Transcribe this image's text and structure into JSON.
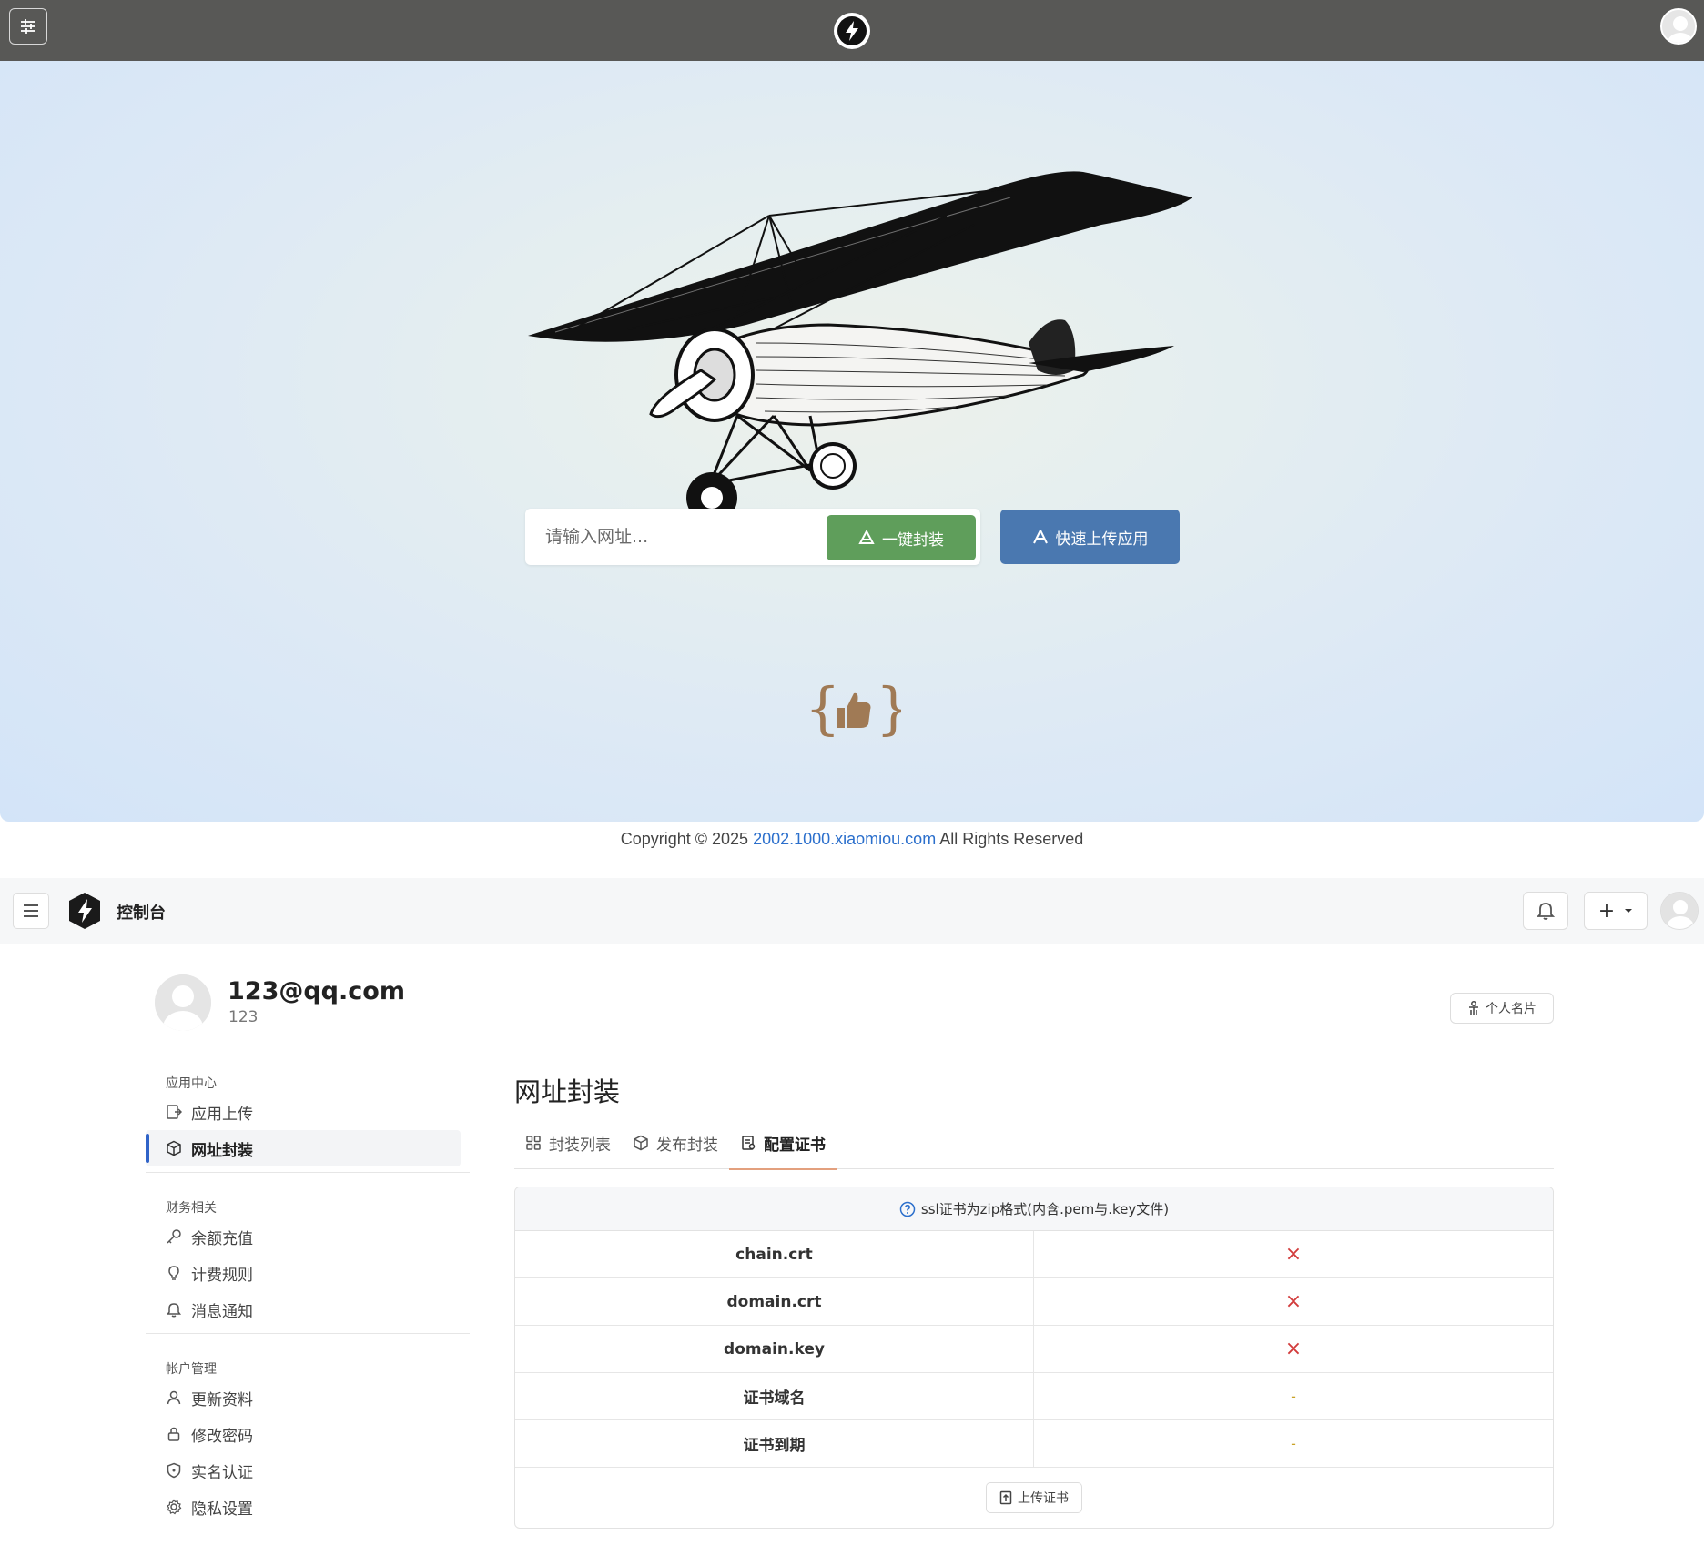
{
  "top": {
    "url_placeholder": "请输入网址...",
    "pack_button": "一键封装",
    "upload_button": "快速上传应用",
    "copyright_prefix": "Copyright © 2025 ",
    "copyright_link": "2002.1000.xiaomiou.com",
    "copyright_suffix": " All Rights Reserved"
  },
  "console": {
    "title": "控制台",
    "plus_label": "+"
  },
  "profile": {
    "email": "123@qq.com",
    "id": "123",
    "card_button": "个人名片"
  },
  "sidebar": {
    "groups": [
      {
        "title": "应用中心",
        "items": [
          {
            "label": "应用上传",
            "icon": "upload-icon"
          },
          {
            "label": "网址封装",
            "icon": "cube-icon",
            "active": true
          }
        ]
      },
      {
        "title": "财务相关",
        "items": [
          {
            "label": "余额充值",
            "icon": "key-icon"
          },
          {
            "label": "计费规则",
            "icon": "bulb-icon"
          },
          {
            "label": "消息通知",
            "icon": "bell-icon"
          }
        ]
      },
      {
        "title": "帐户管理",
        "items": [
          {
            "label": "更新资料",
            "icon": "user-icon"
          },
          {
            "label": "修改密码",
            "icon": "lock-icon"
          },
          {
            "label": "实名认证",
            "icon": "shield-icon"
          },
          {
            "label": "隐私设置",
            "icon": "gear-icon"
          }
        ]
      }
    ]
  },
  "main": {
    "heading": "网址封装",
    "tabs": [
      {
        "label": "封装列表",
        "icon": "grid-icon"
      },
      {
        "label": "发布封装",
        "icon": "cube-icon"
      },
      {
        "label": "配置证书",
        "icon": "certificate-icon",
        "active": true
      }
    ],
    "cert_note": "ssl证书为zip格式(内含.pem与.key文件)",
    "cert_rows": [
      {
        "name": "chain.crt",
        "status": "×"
      },
      {
        "name": "domain.crt",
        "status": "×"
      },
      {
        "name": "domain.key",
        "status": "×"
      },
      {
        "name": "证书域名",
        "status": "-"
      },
      {
        "name": "证书到期",
        "status": "-"
      }
    ],
    "upload_cert_button": "上传证书"
  },
  "colors": {
    "pack_button": "#5f9e5b",
    "upload_button": "#4a78b0",
    "link": "#2b6fcc",
    "error_mark": "#d23b3b",
    "active_tab_underline": "#e3a07e",
    "active_side_bar": "#2f63c8"
  }
}
